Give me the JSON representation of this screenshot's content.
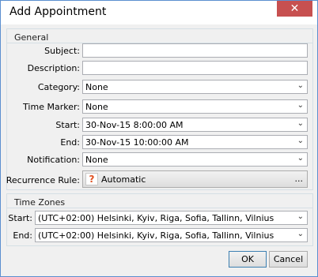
{
  "window": {
    "title": "Add Appointment",
    "close_glyph": "✕"
  },
  "general": {
    "header": "General",
    "subject": {
      "label": "Subject:",
      "value": ""
    },
    "description": {
      "label": "Description:",
      "value": ""
    },
    "category": {
      "label": "Category:",
      "value": "None"
    },
    "time_marker": {
      "label": "Time Marker:",
      "value": "None"
    },
    "start": {
      "label": "Start:",
      "value": "30-Nov-15 8:00:00 AM"
    },
    "end": {
      "label": "End:",
      "value": "30-Nov-15 10:00:00 AM"
    },
    "notification": {
      "label": "Notification:",
      "value": "None"
    },
    "recurrence": {
      "label": "Recurrence Rule:",
      "value": "Automatic",
      "icon": "help-icon",
      "more": "..."
    }
  },
  "time_zones": {
    "header": "Time Zones",
    "start": {
      "label": "Start:",
      "value": "(UTC+02:00) Helsinki, Kyiv, Riga, Sofia, Tallinn, Vilnius"
    },
    "end": {
      "label": "End:",
      "value": "(UTC+02:00) Helsinki, Kyiv, Riga, Sofia, Tallinn, Vilnius"
    }
  },
  "buttons": {
    "ok": "OK",
    "cancel": "Cancel"
  },
  "icons": {
    "dropdown": "chevron-down-icon",
    "close": "close-icon"
  },
  "colors": {
    "close_button": "#c75050",
    "window_border": "#5b8fd0"
  }
}
